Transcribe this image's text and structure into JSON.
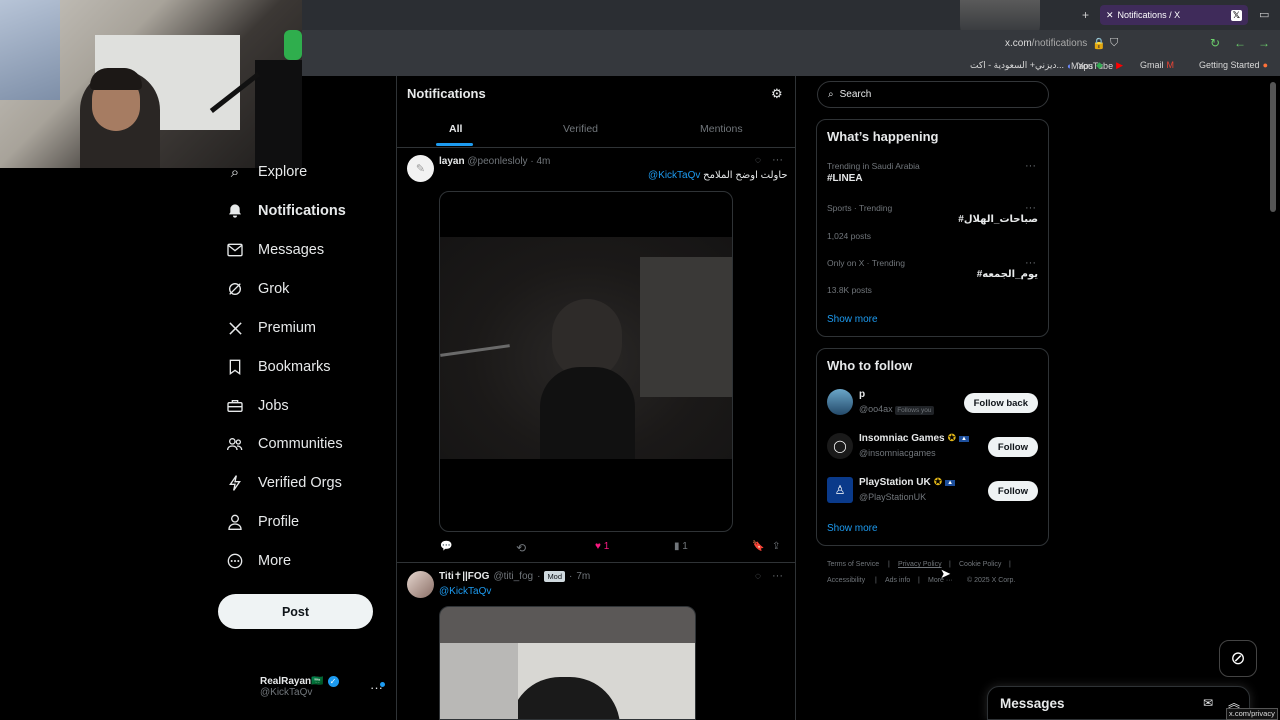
{
  "browser": {
    "tab_title": "Notifications / X",
    "url_domain": "x.com",
    "url_path": "/notifications",
    "status_url": "x.com/privacy",
    "bookmarks": [
      {
        "label": "Getting Started",
        "icon": "firefox-icon"
      },
      {
        "label": "Gmail",
        "icon": "gmail-icon"
      },
      {
        "label": "YouTube",
        "icon": "youtube-icon"
      },
      {
        "label": "Maps",
        "icon": "maps-icon"
      },
      {
        "label": "ديزني+ السعودية - اكت...",
        "icon": "disney-icon"
      }
    ]
  },
  "nav": {
    "items": [
      {
        "label": "Explore",
        "icon": "search-icon",
        "glyph": "⌕"
      },
      {
        "label": "Notifications",
        "icon": "bell-icon",
        "glyph": "🔔",
        "active": true
      },
      {
        "label": "Messages",
        "icon": "envelope-icon",
        "glyph": "✉"
      },
      {
        "label": "Grok",
        "icon": "grok-icon",
        "glyph": "◌"
      },
      {
        "label": "Premium",
        "icon": "x-logo-icon",
        "glyph": "𝕏"
      },
      {
        "label": "Bookmarks",
        "icon": "bookmark-icon",
        "glyph": "🔖"
      },
      {
        "label": "Jobs",
        "icon": "briefcase-icon",
        "glyph": "💼"
      },
      {
        "label": "Communities",
        "icon": "people-icon",
        "glyph": "👥"
      },
      {
        "label": "Verified Orgs",
        "icon": "lightning-icon",
        "glyph": "ϟ"
      },
      {
        "label": "Profile",
        "icon": "person-icon",
        "glyph": "👤"
      },
      {
        "label": "More",
        "icon": "more-circle-icon",
        "glyph": "⋯"
      }
    ],
    "post_label": "Post",
    "account": {
      "name": "RealRayan🇸🇦",
      "handle": "@KickTaQv"
    }
  },
  "notifications": {
    "title": "Notifications",
    "tabs": [
      "All",
      "Verified",
      "Mentions"
    ],
    "active_tab": "All",
    "posts": [
      {
        "name": "layan",
        "handle": "@peonlesloly",
        "time": "4m",
        "text_mention": "@KickTaQv",
        "text_body": "حاولت اوضح الملامح",
        "likes": "1",
        "views": "1"
      },
      {
        "name": "Titi✝||FOG",
        "handle": "@titi_fog",
        "badge": "Mod",
        "time": "7m",
        "text_mention": "@KickTaQv"
      }
    ]
  },
  "right": {
    "search_placeholder": "Search",
    "happening": {
      "title": "What’s happening",
      "trends": [
        {
          "context": "Trending in Saudi Arabia",
          "name": "#LINEA",
          "posts": ""
        },
        {
          "context": "Sports · Trending",
          "name": "#صباحات_الهلال",
          "posts": "1,024 posts"
        },
        {
          "context": "Only on X · Trending",
          "name": "#يوم_الجمعه",
          "posts": "13.8K posts"
        }
      ],
      "show_more": "Show more"
    },
    "who_to_follow": {
      "title": "Who to follow",
      "accounts": [
        {
          "name": "p",
          "handle": "@oo4ax",
          "tag": "Follows you",
          "button": "Follow back"
        },
        {
          "name": "Insomniac Games",
          "handle": "@insomniacgames",
          "button": "Follow"
        },
        {
          "name": "PlayStation UK",
          "handle": "@PlayStationUK",
          "button": "Follow"
        }
      ],
      "show_more": "Show more"
    },
    "footer": {
      "links": [
        "Terms of Service",
        "Privacy Policy",
        "Cookie Policy",
        "Accessibility",
        "Ads info",
        "More ···"
      ],
      "copyright": "© 2025 X Corp."
    },
    "messages_label": "Messages"
  },
  "colors": {
    "accent": "#1d9bf0",
    "like": "#f91880",
    "verified_gold": "#e2b719"
  }
}
